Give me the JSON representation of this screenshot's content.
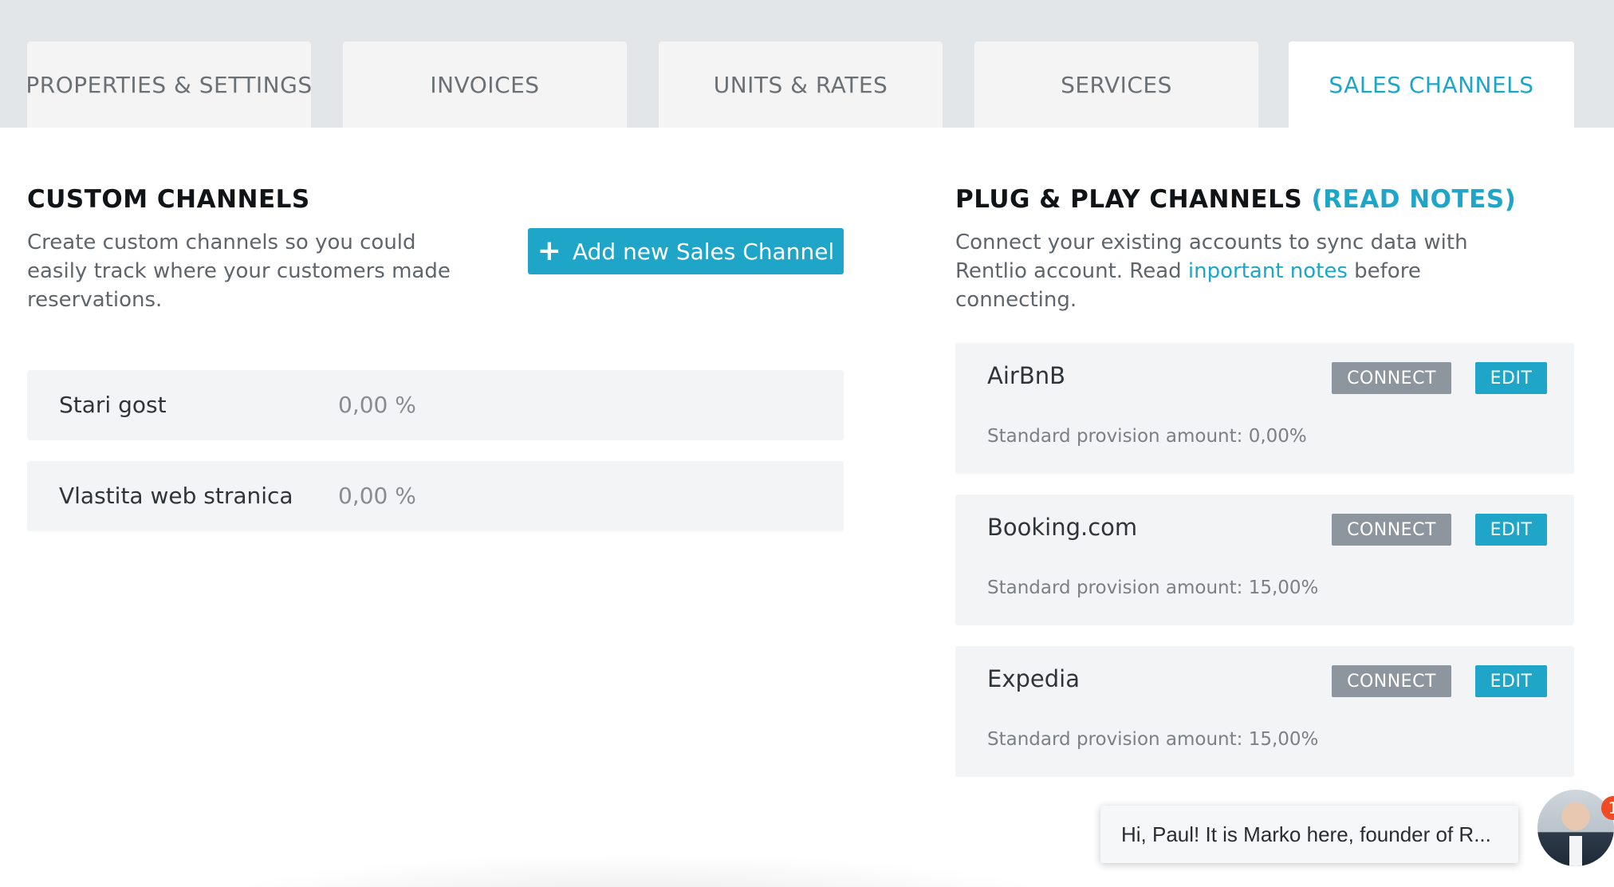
{
  "tabs": [
    {
      "label": "PROPERTIES & SETTINGS",
      "active": false
    },
    {
      "label": "INVOICES",
      "active": false
    },
    {
      "label": "UNITS & RATES",
      "active": false
    },
    {
      "label": "SERVICES",
      "active": false
    },
    {
      "label": "SALES CHANNELS",
      "active": true
    }
  ],
  "custom_channels": {
    "title": "CUSTOM CHANNELS",
    "description": "Create custom channels so you could easily track where your customers made reservations.",
    "add_button_label": "Add new Sales Channel",
    "add_button_icon": "plus-icon",
    "items": [
      {
        "name": "Stari gost",
        "percent": "0,00 %"
      },
      {
        "name": "Vlastita web stranica",
        "percent": "0,00 %"
      }
    ]
  },
  "plug_play": {
    "title": "PLUG & PLAY CHANNELS",
    "title_link": "(READ NOTES)",
    "description_prefix": "Connect your existing accounts to sync data with Rentlio account. Read ",
    "description_link": "inportant notes",
    "description_suffix": " before connecting.",
    "channels": [
      {
        "name": "AirBnB",
        "provision": "Standard provision amount: 0,00%",
        "connect_label": "CONNECT",
        "edit_label": "EDIT"
      },
      {
        "name": "Booking.com",
        "provision": "Standard provision amount: 15,00%",
        "connect_label": "CONNECT",
        "edit_label": "EDIT"
      },
      {
        "name": "Expedia",
        "provision": "Standard provision amount: 15,00%",
        "connect_label": "CONNECT",
        "edit_label": "EDIT"
      }
    ]
  },
  "chat": {
    "message": "Hi, Paul! It is Marko here, founder of R...",
    "badge_count": "1"
  },
  "colors": {
    "accent": "#1ea5c8",
    "connect_button": "#8d969e",
    "badge": "#f04b23"
  }
}
